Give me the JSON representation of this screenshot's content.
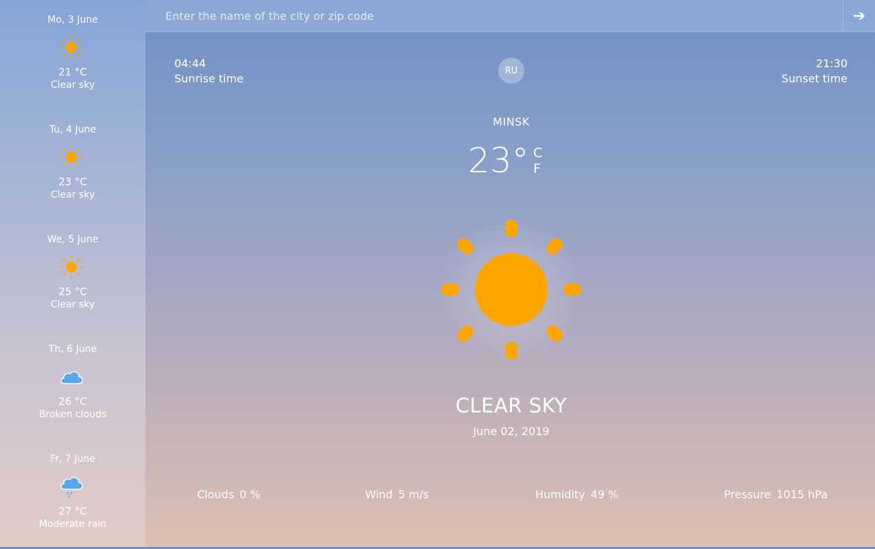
{
  "search": {
    "placeholder": "Enter the name of the city or zip code"
  },
  "forecast": [
    {
      "date": "Mo, 3 June",
      "temp": "21 °C",
      "desc": "Clear sky",
      "icon": "sun-icon"
    },
    {
      "date": "Tu, 4 June",
      "temp": "23 °C",
      "desc": "Clear sky",
      "icon": "sun-icon"
    },
    {
      "date": "We, 5 June",
      "temp": "25 °C",
      "desc": "Clear sky",
      "icon": "sun-icon"
    },
    {
      "date": "Th, 6 June",
      "temp": "26 °C",
      "desc": "Broken clouds",
      "icon": "cloud-icon"
    },
    {
      "date": "Fr, 7 June",
      "temp": "27 °C",
      "desc": "Moderate rain",
      "icon": "rain-cloud-icon"
    }
  ],
  "sunrise": {
    "time": "04:44",
    "label": "Sunrise time"
  },
  "sunset": {
    "time": "21:30",
    "label": "Sunset time"
  },
  "language": "RU",
  "city": "MINSK",
  "temperature": "23°",
  "units": {
    "c": "C",
    "f": "F"
  },
  "condition": "CLEAR SKY",
  "date": "June 02, 2019",
  "stats": {
    "clouds": {
      "label": "Clouds",
      "value": "0 %"
    },
    "wind": {
      "label": "Wind",
      "value": "5 m/s"
    },
    "humidity": {
      "label": "Humidity",
      "value": "49 %"
    },
    "pressure": {
      "label": "Pressure",
      "value": "1015 hPa"
    }
  },
  "colors": {
    "sun": "#ffa500",
    "cloud": "#5aa7f0"
  }
}
